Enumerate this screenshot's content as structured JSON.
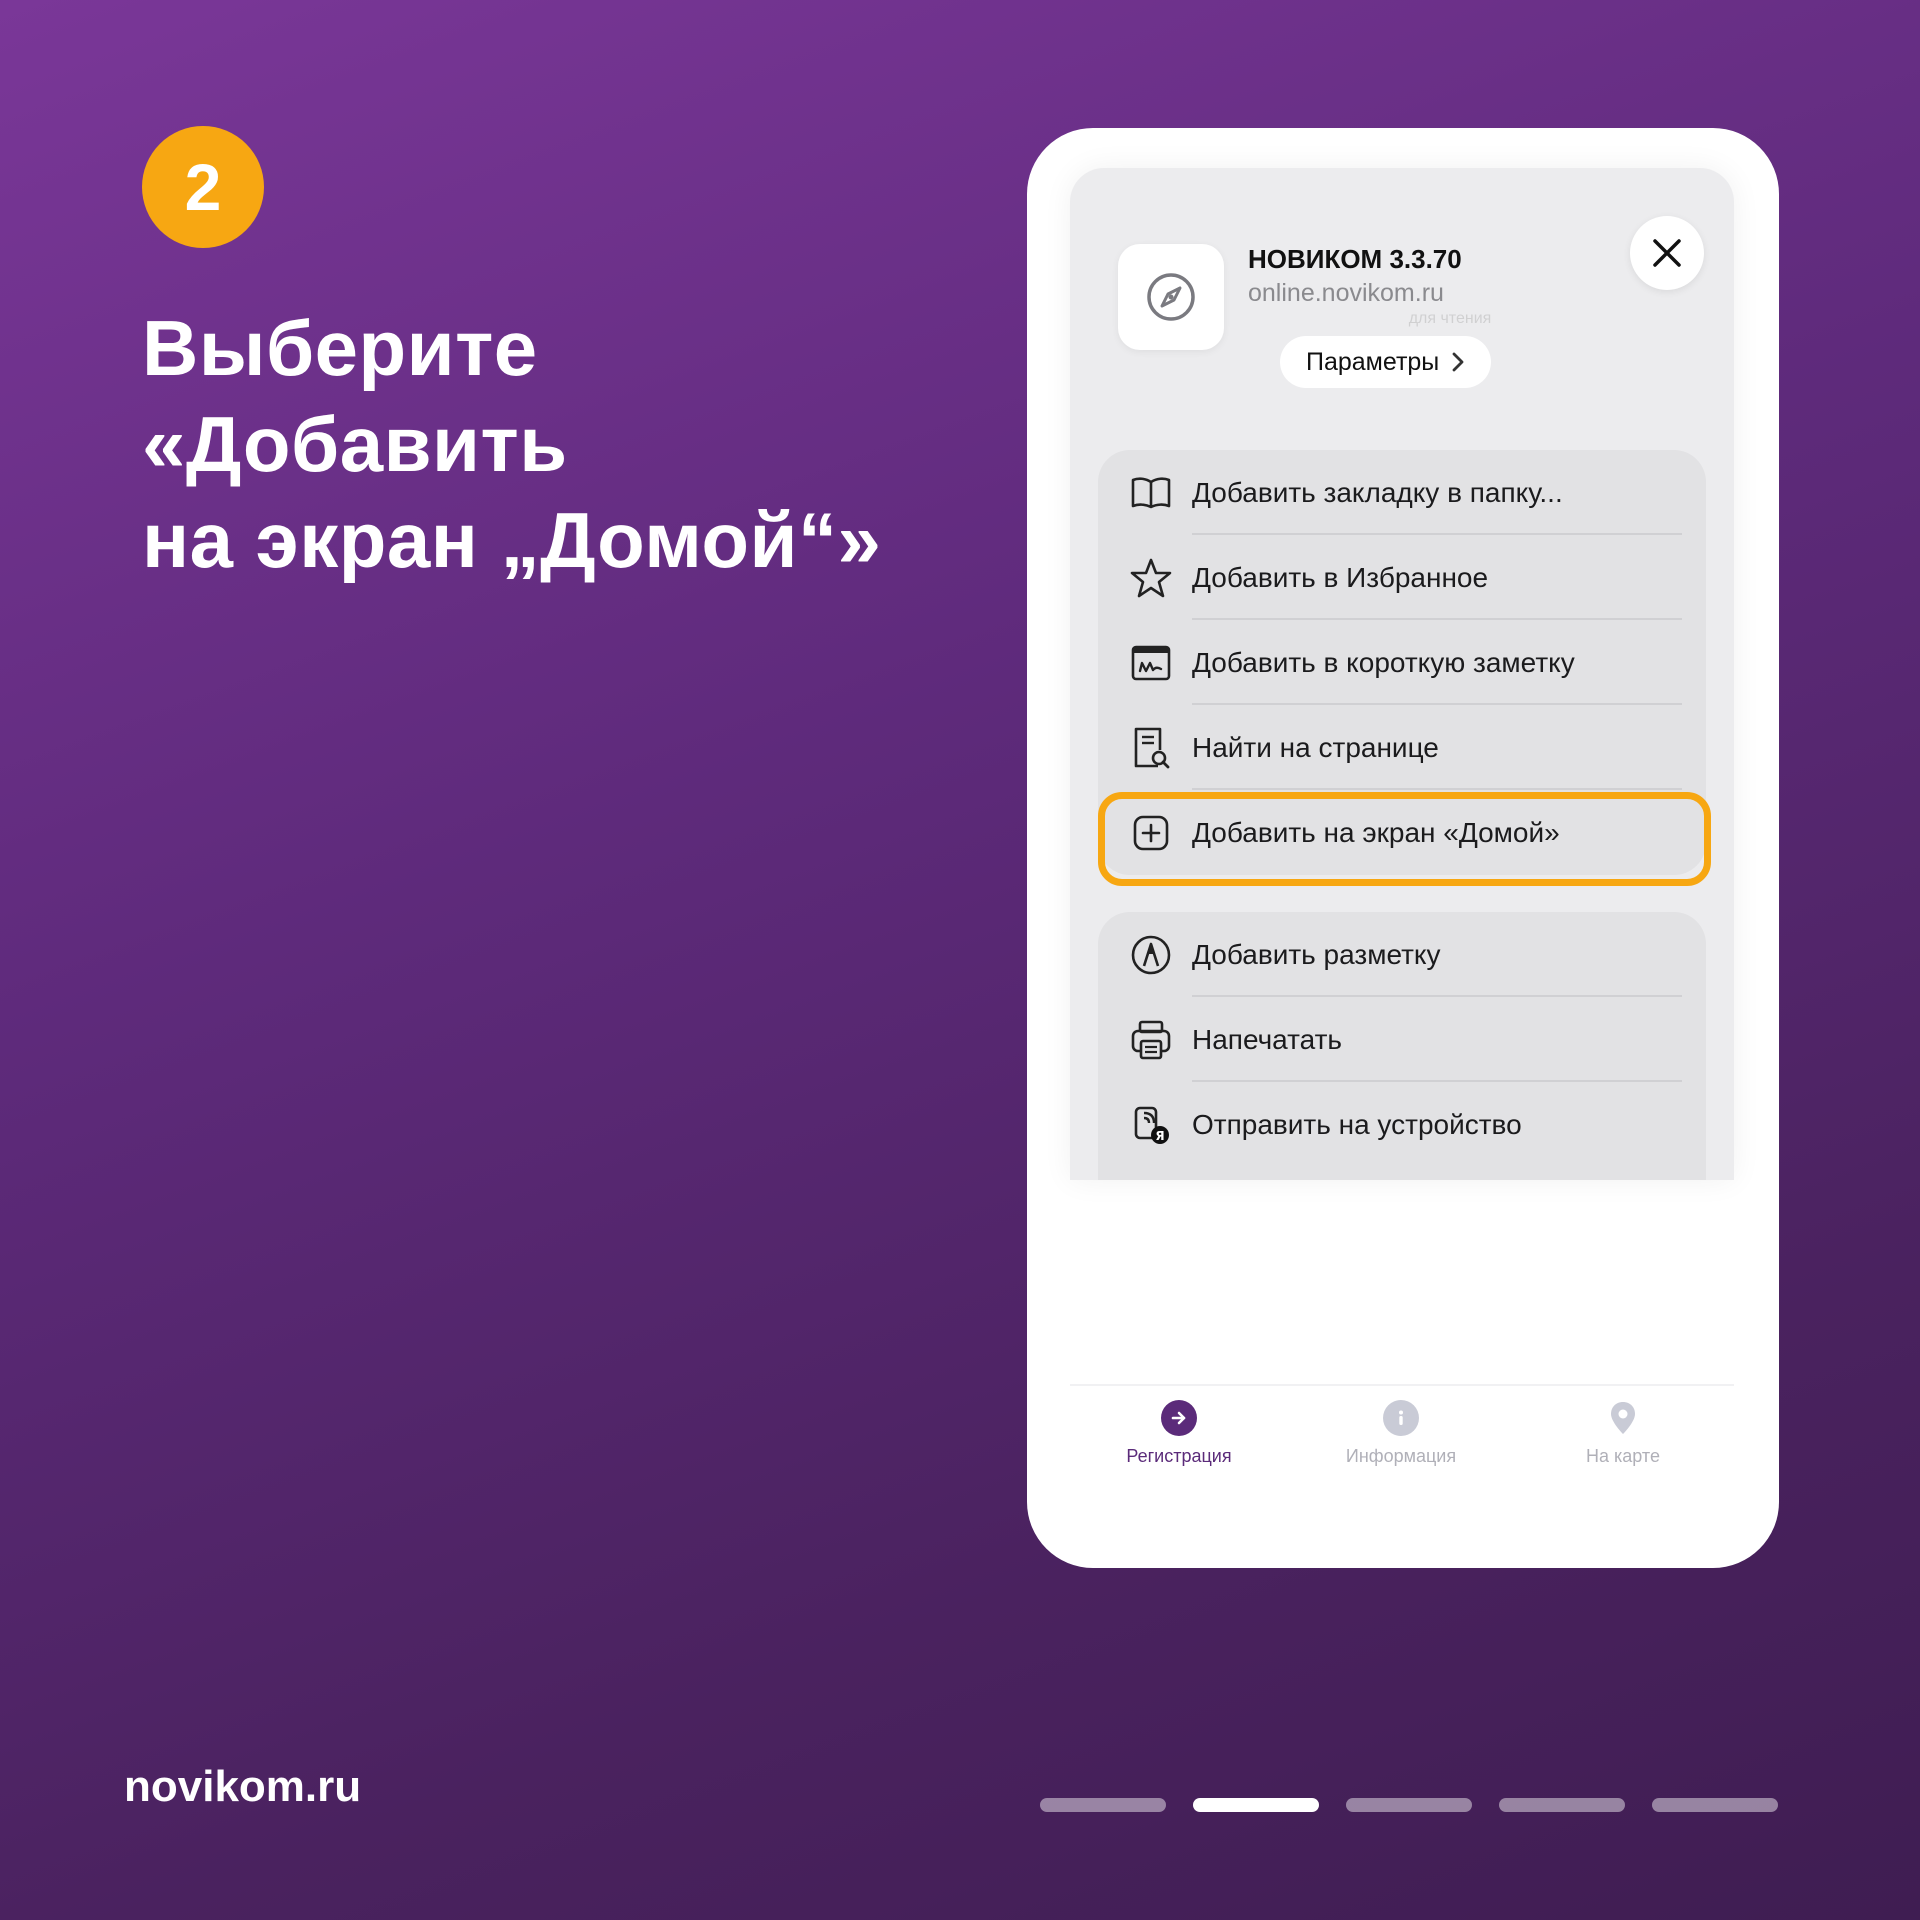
{
  "step": {
    "number": "2"
  },
  "headline": {
    "line1": "Выберите",
    "line2": "«Добавить",
    "line3": "на экран „Домой“»"
  },
  "brand": "novikom.ru",
  "pager": {
    "total": 5,
    "active_index": 1
  },
  "sheet": {
    "app_title": "НОВИКОМ 3.3.70",
    "app_url": "online.novikom.ru",
    "params_label": "Параметры",
    "ghost_labels": [
      "для чтения"
    ],
    "group1": [
      {
        "label": "Добавить закладку в папку...",
        "icon": "book-icon"
      },
      {
        "label": "Добавить в Избранное",
        "icon": "star-icon"
      },
      {
        "label": "Добавить в короткую заметку",
        "icon": "quick-note-icon"
      },
      {
        "label": "Найти на странице",
        "icon": "find-in-page-icon"
      },
      {
        "label": "Добавить на экран «Домой»",
        "icon": "add-square-icon",
        "highlighted": true
      }
    ],
    "group2": [
      {
        "label": "Добавить разметку",
        "icon": "markup-icon"
      },
      {
        "label": "Напечатать",
        "icon": "print-icon"
      },
      {
        "label": "Отправить на устройство",
        "icon": "send-to-device-icon"
      }
    ]
  },
  "tabbar": [
    {
      "label": "Регистрация",
      "icon": "arrow-right-circle-icon",
      "active": true
    },
    {
      "label": "Информация",
      "icon": "info-icon",
      "active": false
    },
    {
      "label": "На карте",
      "icon": "map-pin-icon",
      "active": false
    }
  ],
  "colors": {
    "accent": "#f7a712",
    "background_top": "#7a3798",
    "background_bottom": "#3f1d52",
    "tab_active": "#5b2b7a"
  }
}
